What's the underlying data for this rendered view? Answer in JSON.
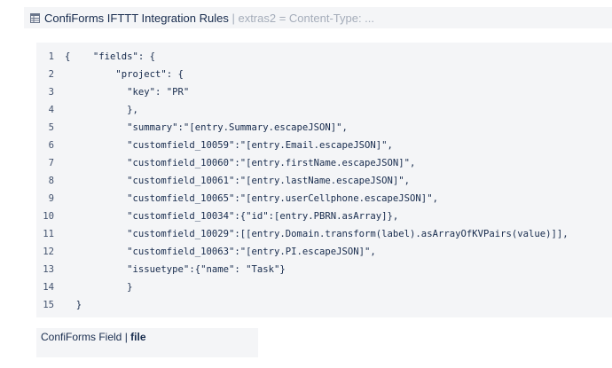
{
  "header": {
    "icon": "table-icon",
    "title": "ConfiForms IFTTT Integration Rules",
    "separator": "|",
    "subtitle": "extras2 = Content-Type: ..."
  },
  "code": {
    "lines": [
      {
        "number": "1",
        "text": "{    \"fields\": {"
      },
      {
        "number": "2",
        "text": "         \"project\": {"
      },
      {
        "number": "3",
        "text": "           \"key\": \"PR\""
      },
      {
        "number": "4",
        "text": "           },"
      },
      {
        "number": "5",
        "text": "           \"summary\":\"[entry.Summary.escapeJSON]\","
      },
      {
        "number": "6",
        "text": "           \"customfield_10059\":\"[entry.Email.escapeJSON]\","
      },
      {
        "number": "7",
        "text": "           \"customfield_10060\":\"[entry.firstName.escapeJSON]\","
      },
      {
        "number": "8",
        "text": "           \"customfield_10061\":\"[entry.lastName.escapeJSON]\","
      },
      {
        "number": "9",
        "text": "           \"customfield_10065\":\"[entry.userCellphone.escapeJSON]\","
      },
      {
        "number": "10",
        "text": "           \"customfield_10034\":{\"id\":[entry.PBRN.asArray]},"
      },
      {
        "number": "11",
        "text": "           \"customfield_10029\":[[entry.Domain.transform(label).asArrayOfKVPairs(value)]],"
      },
      {
        "number": "12",
        "text": "           \"customfield_10063\":\"[entry.PI.escapeJSON]\","
      },
      {
        "number": "13",
        "text": "           \"issuetype\":{\"name\": \"Task\"}"
      },
      {
        "number": "14",
        "text": "           }"
      },
      {
        "number": "15",
        "text": "  }"
      }
    ]
  },
  "field_panel": {
    "label": "ConfiForms Field",
    "separator": "|",
    "value": "file"
  }
}
